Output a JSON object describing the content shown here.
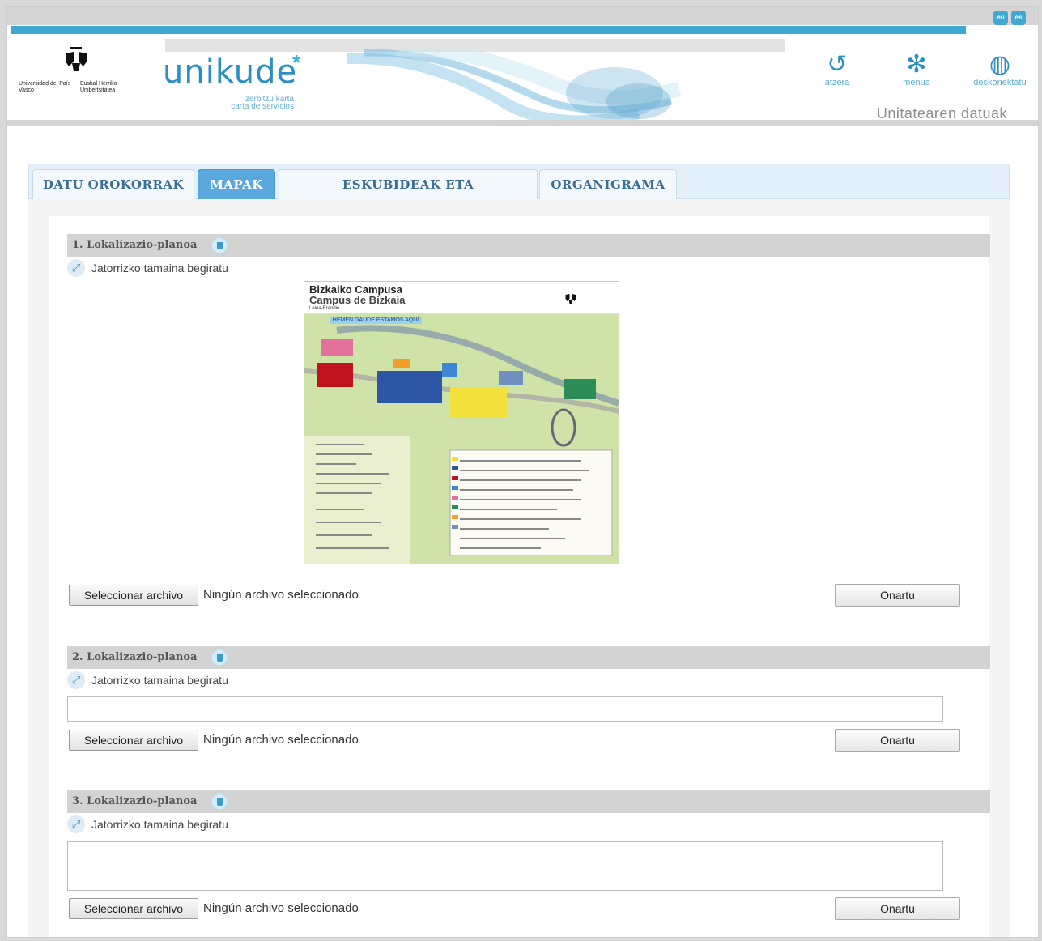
{
  "header": {
    "languages": [
      "eu",
      "es"
    ],
    "university": {
      "name_es": "Universidad del País Vasco",
      "name_eu": "Euskal Herriko Unibertsitatea"
    },
    "brand": {
      "name": "unikude",
      "star": "*",
      "subtitle_eu": "zerbitzu karta",
      "subtitle_es": "carta de servicios"
    },
    "nav": [
      {
        "label": "atzera",
        "icon": "back-arrow-icon"
      },
      {
        "label": "menua",
        "icon": "menu-asterisk-icon"
      },
      {
        "label": "deskonektatu",
        "icon": "globe-disconnect-icon"
      }
    ],
    "page_subtitle": "Unitatearen datuak"
  },
  "tabs": [
    {
      "label": "DATU OROKORRAK",
      "active": false
    },
    {
      "label": "MAPAK",
      "active": true
    },
    {
      "label": "ESKUBIDEAK ETA BETEBEHARRAK",
      "active": false
    },
    {
      "label": "ORGANIGRAMA",
      "active": false
    }
  ],
  "sections": [
    {
      "title": "1. Lokalizazio-planoa",
      "view_link": "Jatorrizko tamaina begiratu",
      "has_image": true,
      "map": {
        "title": "Bizkaiko Campusa",
        "subtitle": "Campus de Bizkaia",
        "place": "Leioa-Erandio",
        "note": "HEMEN GAUDE ESTAMOS AQUÍ"
      },
      "file_button": "Seleccionar archivo",
      "file_status": "Ningún archivo seleccionado",
      "submit": "Onartu"
    },
    {
      "title": "2. Lokalizazio-planoa",
      "view_link": "Jatorrizko tamaina begiratu",
      "has_image": false,
      "file_button": "Seleccionar archivo",
      "file_status": "Ningún archivo seleccionado",
      "submit": "Onartu"
    },
    {
      "title": "3. Lokalizazio-planoa",
      "view_link": "Jatorrizko tamaina begiratu",
      "has_image": false,
      "file_button": "Seleccionar archivo",
      "file_status": "Ningún archivo seleccionado",
      "submit": "Onartu"
    }
  ],
  "colors": {
    "accent": "#3fa9d2",
    "tab_active": "#5aa9de",
    "section_header": "#d3d3d3"
  }
}
